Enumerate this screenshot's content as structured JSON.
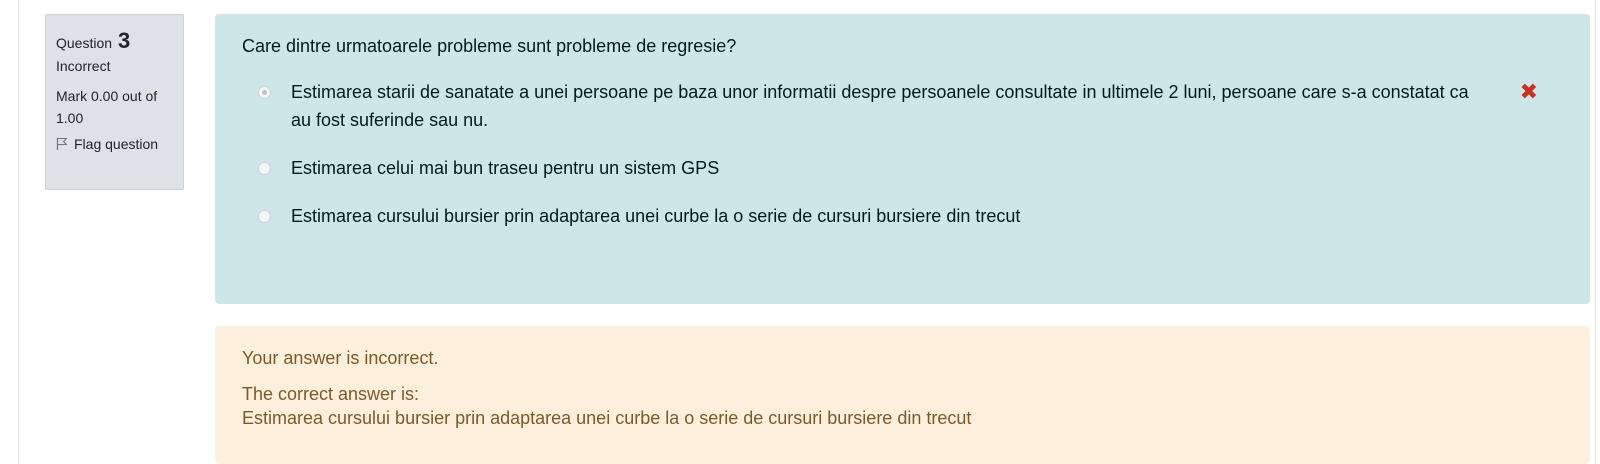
{
  "question_info": {
    "label": "Question",
    "number": "3",
    "state": "Incorrect",
    "grade": "Mark 0.00 out of 1.00",
    "flag_label": "Flag question"
  },
  "question": {
    "text": "Care dintre urmatoarele probleme sunt probleme de regresie?",
    "answers": [
      {
        "text": "Estimarea starii de sanatate a unei persoane pe baza unor informatii despre persoanele consultate in ultimele 2 luni, persoane care s-a constatat ca au fost suferinde sau nu.",
        "selected": true,
        "mark": "✖"
      },
      {
        "text": "Estimarea celui mai bun traseu pentru un sistem GPS",
        "selected": false
      },
      {
        "text": "Estimarea cursului bursier prin adaptarea unei curbe la o serie de cursuri bursiere din trecut",
        "selected": false
      }
    ]
  },
  "feedback": {
    "status": "Your answer is incorrect.",
    "correct_label": "The correct answer is:",
    "correct_answer": "Estimarea cursului bursier prin adaptarea unei curbe la o serie de cursuri bursiere din trecut"
  },
  "colors": {
    "info_bg": "#dee2e6",
    "question_bg": "#cde6ea",
    "feedback_bg": "#fcefdc",
    "incorrect_mark": "#ca3120"
  }
}
